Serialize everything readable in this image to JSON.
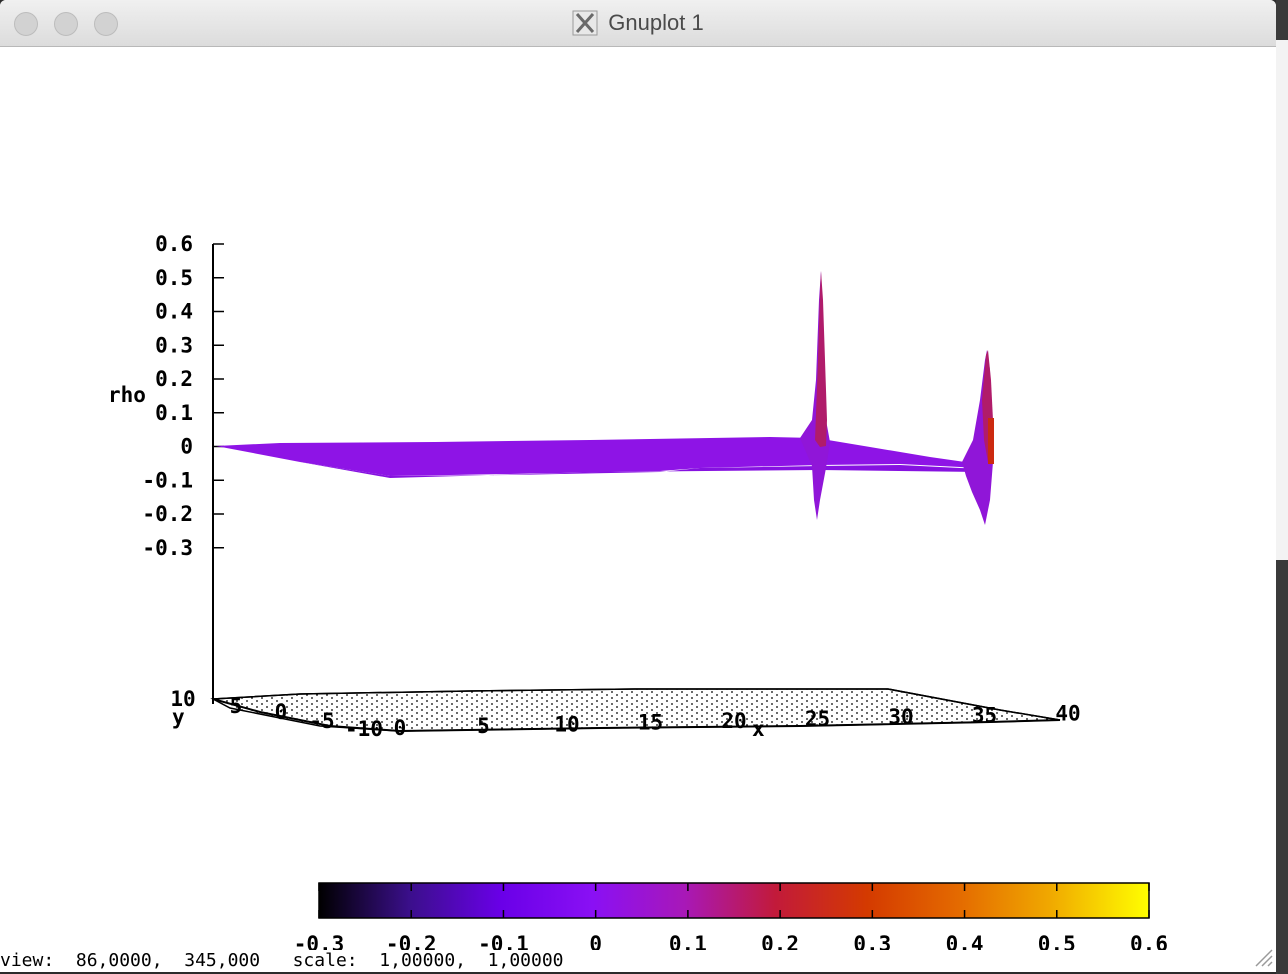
{
  "window": {
    "title": "Gnuplot 1",
    "app_icon": "x11-icon"
  },
  "chart_data": {
    "type": "surface-3d",
    "style": "pm3d surface with base projection",
    "zlabel": "rho",
    "xlabel": "x",
    "ylabel": "y",
    "z_ticks": [
      "0.6",
      "0.5",
      "0.4",
      "0.3",
      "0.2",
      "0.1",
      "0",
      "-0.1",
      "-0.2",
      "-0.3"
    ],
    "x_ticks": [
      "0",
      "5",
      "10",
      "15",
      "20",
      "25",
      "30",
      "35",
      "40"
    ],
    "y_ticks": [
      "10",
      "5",
      "0",
      "-5",
      "-10"
    ],
    "xlim": [
      0,
      40
    ],
    "zlim": [
      -0.3,
      0.6
    ],
    "peaks": [
      {
        "x": 25,
        "z_max": 0.52,
        "z_min": -0.22
      },
      {
        "x": 35,
        "z_max": 0.28,
        "z_min": -0.23
      }
    ],
    "colorbox": {
      "min": -0.3,
      "max": 0.6,
      "ticks": [
        "-0.3",
        "-0.2",
        "-0.1",
        "0",
        "0.1",
        "0.2",
        "0.3",
        "0.4",
        "0.5",
        "0.6"
      ],
      "palette": [
        "#000000",
        "#3b0f8c",
        "#6a00e8",
        "#8a10f4",
        "#a818b8",
        "#c21a3a",
        "#d43a00",
        "#e46a00",
        "#f0a800",
        "#ffff00"
      ]
    },
    "colors": {
      "surface_main": "#8e14e6",
      "surface_peak": "#b01c6a",
      "surface_hot": "#cc2a10"
    }
  },
  "status": {
    "text": "view:  86,0000,  345,000   scale:  1,00000,  1,00000"
  }
}
